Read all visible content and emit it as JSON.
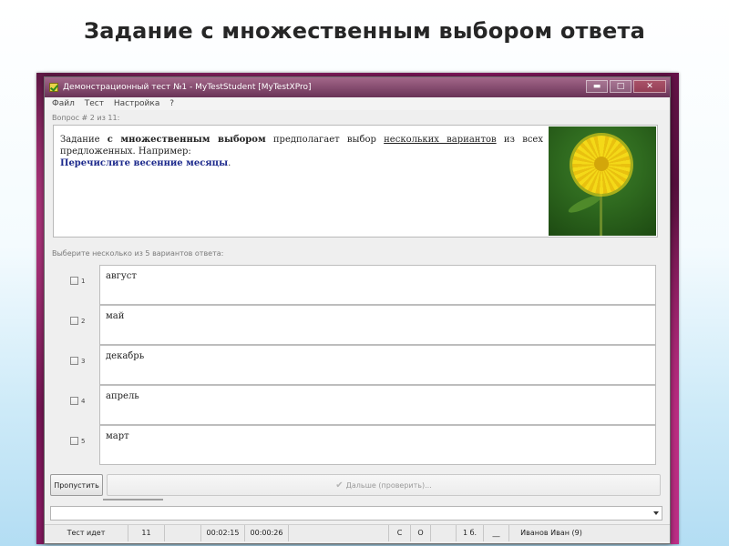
{
  "slide": {
    "title": "Задание с множественным  выбором ответа"
  },
  "window": {
    "title": "Демонстрационный тест №1 - MyTestStudent [MyTestXPro]",
    "buttons": {
      "minimize": "▬",
      "maximize": "□",
      "close": "✕"
    }
  },
  "menu": [
    "Файл",
    "Тест",
    "Настройка",
    "?"
  ],
  "question": {
    "number_text": "Вопрос # 2 из 11:",
    "text_parts": {
      "p1": "Задание ",
      "bold": "с множественным выбором",
      "p2": " предполагает выбор ",
      "underline": "нескольких вариантов",
      "p3": " из всех предложенных. Например:",
      "ask": "Перечислите весенние месяцы",
      "end": "."
    },
    "image": "dandelion-photo"
  },
  "answers": {
    "hint": "Выберите несколько из 5 вариантов ответа:",
    "items": [
      {
        "num": "1",
        "text": "август",
        "checked": false
      },
      {
        "num": "2",
        "text": "май",
        "checked": false
      },
      {
        "num": "3",
        "text": "декабрь",
        "checked": false
      },
      {
        "num": "4",
        "text": "апрель",
        "checked": false
      },
      {
        "num": "5",
        "text": "март",
        "checked": false
      }
    ]
  },
  "buttons": {
    "skip": "Пропустить",
    "next": "Дальше (проверить)..."
  },
  "status": {
    "state": "Тест идет",
    "question_count": "11",
    "elapsed": "00:02:15",
    "question_time": "00:00:26",
    "c": "С",
    "o": "О",
    "score": "1 б.",
    "blank": "__",
    "user": "Иванов Иван (9)"
  },
  "colors": {
    "question_accent": "#1d2a8c",
    "window_bg": "#efefef"
  }
}
